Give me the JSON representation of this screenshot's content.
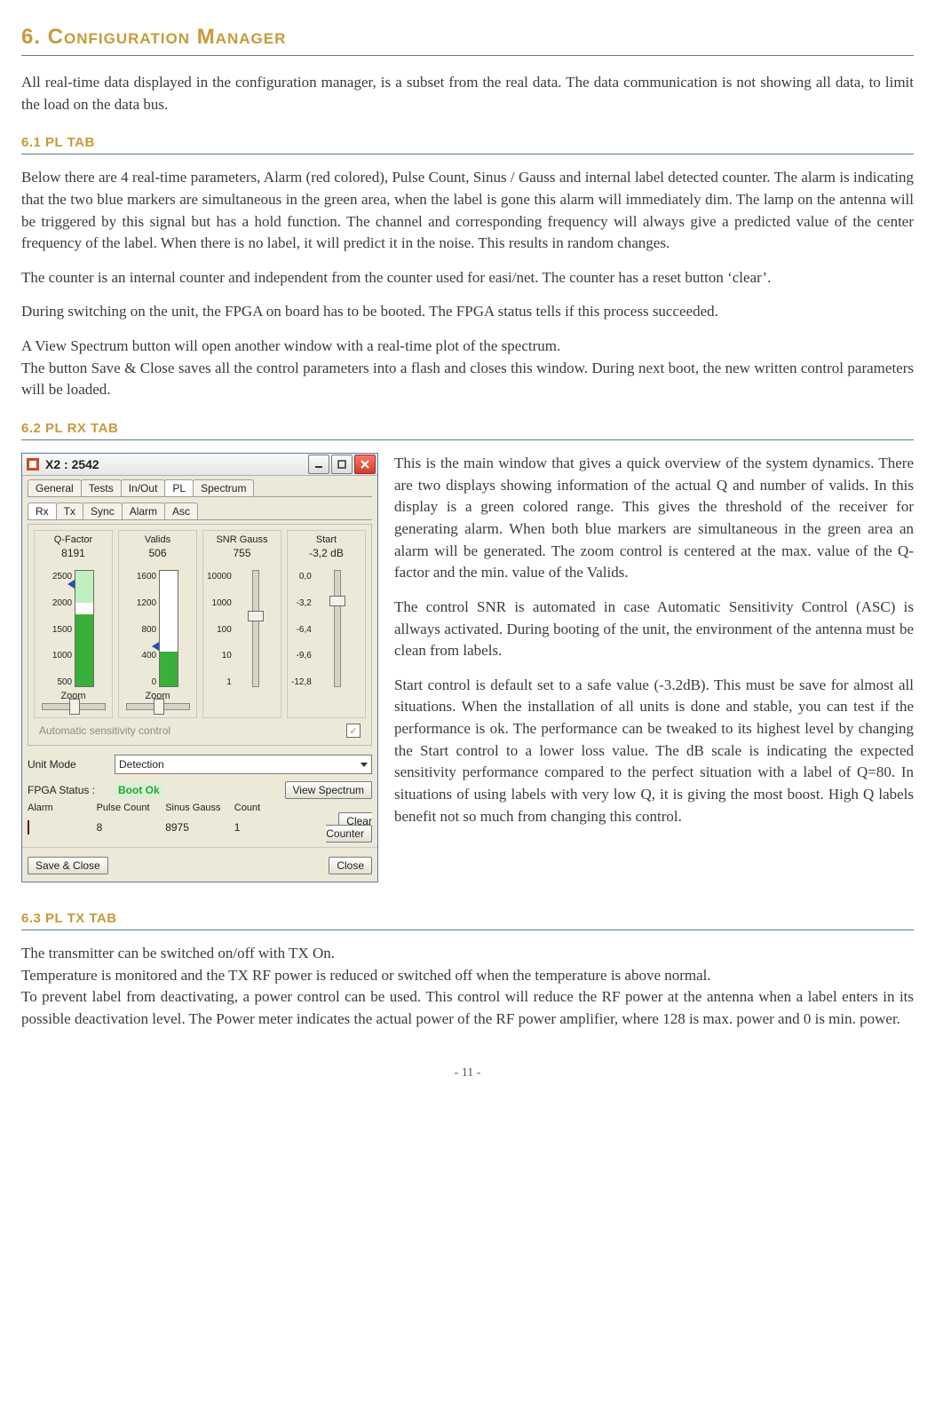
{
  "headings": {
    "h1": "6. Configuration Manager",
    "h61": "6.1 PL TAB",
    "h62": "6.2 PL RX TAB",
    "h63": "6.3 PL TX TAB"
  },
  "para": {
    "intro": "All real-time data displayed in the configuration manager, is a subset from the real data. The data communication is not showing all data, to limit the load on the data bus.",
    "p61a": "Below there are 4 real-time parameters, Alarm (red colored), Pulse Count, Sinus / Gauss and internal label detected counter. The alarm is indicating that the two blue markers are simultaneous in the green area, when the label is gone this alarm will immediately dim. The lamp on the antenna will be triggered by this signal but has a hold function. The channel and corresponding frequency will always give a predicted value of the center frequency of the label. When there is no label, it will predict it in the noise. This results in random changes.",
    "p61b": "The counter is an internal counter and independent from the counter used for easi/net. The counter has a reset button ‘clear’.",
    "p61c": "During switching on the unit, the FPGA on board has to be booted. The FPGA status tells if this process succeeded.",
    "p61d": "A View Spectrum button will open another window with a real-time plot of the spectrum.",
    "p61e": "The button Save & Close saves all the control parameters into a flash and closes this window. During next boot, the new written control parameters will be loaded.",
    "p62a": "This is the main window that gives a quick overview of the system dynamics. There are two displays showing information of the actual Q and number of valids. In this display is a green colored range. This gives the threshold of the receiver for generating alarm. When both blue markers are simultaneous in the green area an alarm will be generated. The zoom control is centered at the max. value of the Q-factor and the min. value of the Valids.",
    "p62b": "The control SNR is automated in case Automatic Sensitivity Control (ASC) is allways activated. During booting of the unit, the environment of the antenna must be clean from labels.",
    "p62c": "Start control is default set to a safe value (-3.2dB). This must be save for almost all situations. When the installation of all units is done and stable, you can test if the performance is ok. The performance can be tweaked to its highest level by changing the Start control to a lower loss value. The dB scale is indicating the expected sensitivity performance compared to the perfect situation with a label of Q=80. In situations of using labels with very low Q, it is giving the most boost. High Q labels benefit not so much from changing this control.",
    "p63a": "The transmitter can be switched on/off with TX On.",
    "p63b": "Temperature is monitored and the TX RF power is reduced or switched off when the temperature is above normal.",
    "p63c": "To prevent label from deactivating, a power control can be used. This control will reduce the RF power at the antenna when a label enters in its possible deactivation level. The Power meter indicates the actual power of the RF power amplifier, where 128 is max. power and 0 is min. power."
  },
  "page_number": "- 11 -",
  "window": {
    "title": "X2 : 2542",
    "tabs": {
      "t0": "General",
      "t1": "Tests",
      "t2": "In/Out",
      "t3": "PL",
      "t4": "Spectrum"
    },
    "subtabs": {
      "s0": "Rx",
      "s1": "Tx",
      "s2": "Sync",
      "s3": "Alarm",
      "s4": "Asc"
    },
    "cols": {
      "q": {
        "title": "Q-Factor",
        "value": "8191",
        "ticks": [
          "2500",
          "2000",
          "1500",
          "1000",
          "500"
        ],
        "zoom": "Zoom"
      },
      "valids": {
        "title": "Valids",
        "value": "506",
        "ticks": [
          "1600",
          "1200",
          "800",
          "400",
          "0"
        ],
        "zoom": "Zoom"
      },
      "snr": {
        "title": "SNR Gauss",
        "value": "755",
        "ticks": [
          "10000",
          "1000",
          "100",
          "10",
          "1"
        ]
      },
      "start": {
        "title": "Start",
        "value": "-3,2 dB",
        "ticks": [
          "0,0",
          "-3,2",
          "-6,4",
          "-9,6",
          "-12,8"
        ]
      }
    },
    "asc_label": "Automatic sensitivity control",
    "asc_checked": "✓",
    "unit_mode_label": "Unit Mode",
    "unit_mode_value": "Detection",
    "fpga_label": "FPGA Status :",
    "fpga_value": "Boot Ok",
    "view_spectrum": "View Spectrum",
    "clear_counter": "Clear Counter",
    "counts_head": {
      "c0": "Alarm",
      "c1": "Pulse Count",
      "c2": "Sinus Gauss",
      "c3": "Count"
    },
    "counts": {
      "pulse": "8",
      "sinus": "8975",
      "count": "1"
    },
    "save_close": "Save & Close",
    "close": "Close"
  }
}
